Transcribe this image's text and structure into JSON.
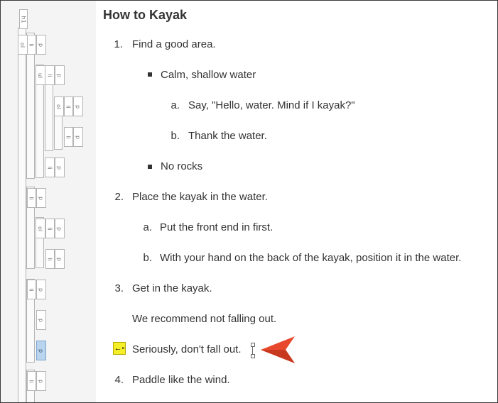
{
  "document": {
    "title": "How to Kayak",
    "items": [
      {
        "num": "1.",
        "text": "Find a good area."
      },
      {
        "bullet": true,
        "text": "Calm, shallow water"
      },
      {
        "num": "a.",
        "text": "Say, \"Hello, water. Mind if I kayak?\""
      },
      {
        "num": "b.",
        "text": "Thank the water."
      },
      {
        "bullet": true,
        "text": "No rocks"
      },
      {
        "num": "2.",
        "text": "Place the kayak in the water."
      },
      {
        "num": "a.",
        "text": "Put the front end in first."
      },
      {
        "num": "b.",
        "text": "With your hand on the back of the kayak, position it in the water."
      },
      {
        "num": "3.",
        "text": "Get in the kayak."
      },
      {
        "text": "We recommend not falling out."
      },
      {
        "text": "Seriously, don't fall out."
      },
      {
        "num": "4.",
        "text": "Paddle like the wind."
      }
    ]
  },
  "tags": {
    "h1": "h1",
    "ol": "ol",
    "ul": "ul",
    "li": "li",
    "p": "p"
  },
  "colors": {
    "selected_tag": "#b8d4ee",
    "pointer_arrow": "#e8492c",
    "marker": "#f5ef2a"
  },
  "icons": {
    "marker": "arrow-left-marker-icon",
    "pointer": "pointer-arrow-icon"
  }
}
